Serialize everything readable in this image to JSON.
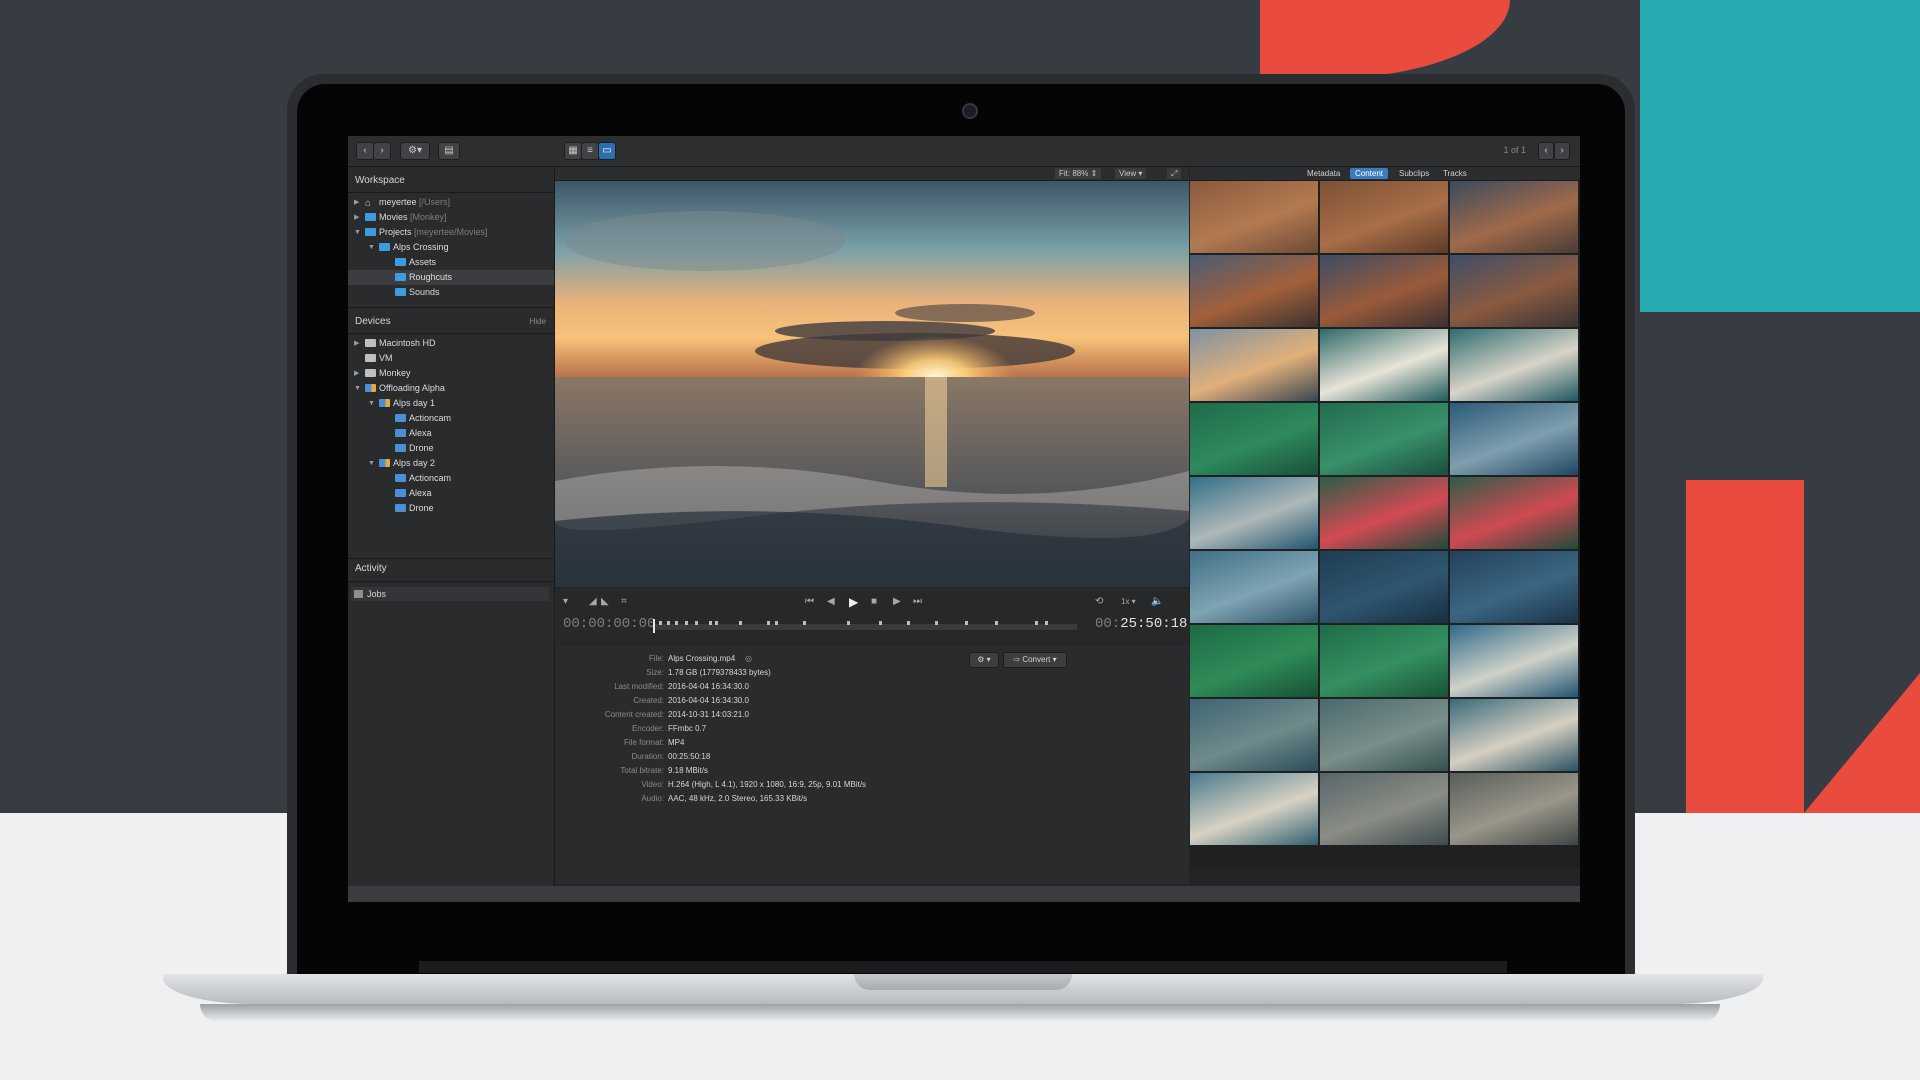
{
  "toolbar": {
    "back_icon": "chevron-left-icon",
    "forward_icon": "chevron-right-icon",
    "settings_icon": "gear-icon",
    "new_folder_icon": "folder-plus-icon",
    "view_modes": [
      "grid-view-icon",
      "list-view-icon",
      "single-view-icon"
    ],
    "page_indicator": "1 of 1"
  },
  "sidebar": {
    "workspace_title": "Workspace",
    "workspace_items": [
      {
        "label": "meyertee",
        "path": "[/Users]"
      },
      {
        "label": "Movies",
        "path": "[Monkey]"
      },
      {
        "label": "Projects",
        "path": "[meyertee/Movies]"
      },
      {
        "label": "Alps Crossing",
        "path": ""
      },
      {
        "label": "Assets",
        "path": ""
      },
      {
        "label": "Roughcuts",
        "path": ""
      },
      {
        "label": "Sounds",
        "path": ""
      }
    ],
    "devices_title": "Devices",
    "devices_hide": "Hide",
    "device_items": [
      {
        "label": "Macintosh HD"
      },
      {
        "label": "VM"
      },
      {
        "label": "Monkey"
      },
      {
        "label": "Offloading Alpha"
      },
      {
        "label": "Alps day 1"
      },
      {
        "label": "Actioncam"
      },
      {
        "label": "Alexa"
      },
      {
        "label": "Drone"
      },
      {
        "label": "Alps day 2"
      },
      {
        "label": "Actioncam"
      },
      {
        "label": "Alexa"
      },
      {
        "label": "Drone"
      }
    ],
    "activity_title": "Activity",
    "jobs_label": "Jobs"
  },
  "viewer": {
    "fit_label": "Fit: 88%",
    "view_label": "View",
    "fullscreen_icon": "expand-icon"
  },
  "transport": {
    "timecode_start": "00:00:00:00",
    "timecode_end_prefix": "00:",
    "timecode_end": "25:50:18",
    "rate_label": "1x",
    "icons": [
      "marker-icon",
      "mark-in-icon",
      "mark-out-icon",
      "crop-icon",
      "skip-back-icon",
      "step-back-icon",
      "play-icon",
      "stop-icon",
      "step-forward-icon",
      "skip-forward-icon",
      "loop-icon",
      "volume-icon"
    ]
  },
  "info": {
    "convert_label": "Convert",
    "rows": [
      {
        "key": "File:",
        "value": "Alps Crossing.mp4"
      },
      {
        "key": "Size:",
        "value": "1.78 GB (1779378433 bytes)"
      },
      {
        "key": "Last modified:",
        "value": "2016-04-04 16:34:30.0"
      },
      {
        "key": "Created:",
        "value": "2016-04-04 16:34:30.0"
      },
      {
        "key": "Content created:",
        "value": "2014-10-31 14:03:21.0"
      },
      {
        "key": "Encoder:",
        "value": "FFmbc 0.7"
      },
      {
        "key": "File format:",
        "value": "MP4"
      },
      {
        "key": "Duration:",
        "value": "00:25:50:18"
      },
      {
        "key": "Total bitrate:",
        "value": "9.18 MBit/s"
      },
      {
        "key": "Video:",
        "value": "H.264 (High, L 4.1), 1920 x 1080, 16:9, 25p, 9.01 MBit/s"
      },
      {
        "key": "Audio:",
        "value": "AAC, 48 kHz, 2.0 Stereo, 165.33 KBit/s"
      }
    ]
  },
  "right_panel": {
    "tabs": [
      "Metadata",
      "Content",
      "Subclips",
      "Tracks"
    ],
    "active_tab": "Content"
  },
  "colors": {
    "accent": "#3a7bbf",
    "brand_red": "#e94b3f",
    "brand_teal": "#27a9b0",
    "folder_blue": "#3f9be0"
  }
}
